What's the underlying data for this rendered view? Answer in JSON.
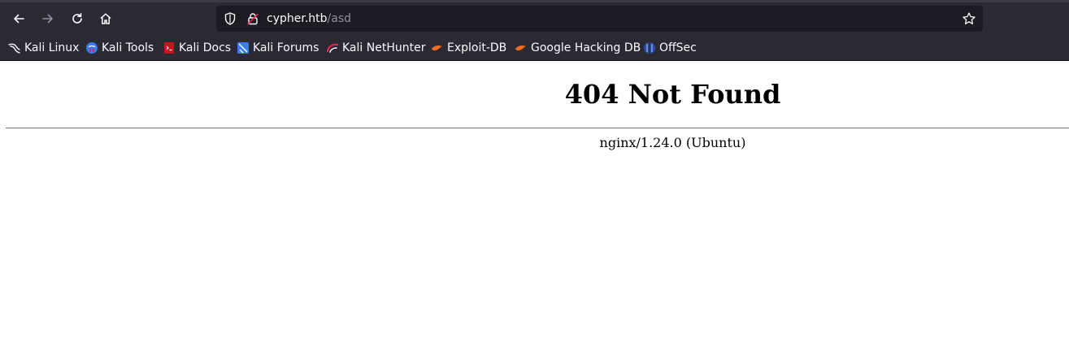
{
  "browser": {
    "url_host": "cypher.htb",
    "url_path": "/asd",
    "nav": {
      "back_icon": "back-arrow-icon",
      "forward_icon": "forward-arrow-icon",
      "reload_icon": "reload-icon",
      "home_icon": "home-icon"
    },
    "bookmarks": [
      {
        "label": "Kali Linux",
        "icon": "kali-dragon-icon"
      },
      {
        "label": "Kali Tools",
        "icon": "kali-tools-icon"
      },
      {
        "label": "Kali Docs",
        "icon": "kali-docs-icon"
      },
      {
        "label": "Kali Forums",
        "icon": "kali-forums-icon"
      },
      {
        "label": "Kali NetHunter",
        "icon": "kali-nethunter-icon"
      },
      {
        "label": "Exploit-DB",
        "icon": "exploit-db-icon"
      },
      {
        "label": "Google Hacking DB",
        "icon": "ghdb-icon"
      },
      {
        "label": "OffSec",
        "icon": "offsec-icon"
      }
    ]
  },
  "page": {
    "heading": "404 Not Found",
    "server_signature": "nginx/1.24.0 (Ubuntu)"
  },
  "colors": {
    "chrome_bg": "#2b2a33",
    "urlbar_bg": "#1c1b22",
    "chrome_text": "#fbfbfe",
    "url_path": "#8f8f9d"
  }
}
